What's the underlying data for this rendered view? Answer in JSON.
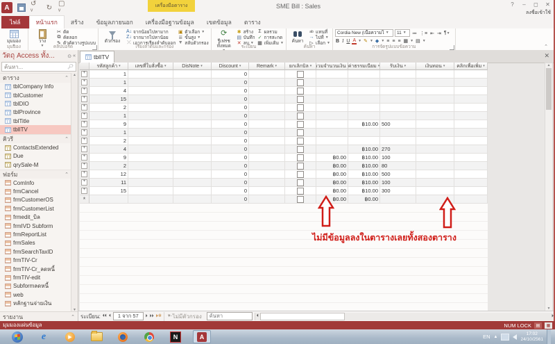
{
  "window": {
    "title": "SME Bill : Sales",
    "sign_in": "ลงชื่อเข้าใช้",
    "controls": {
      "help": "?",
      "minimize": "‒",
      "restore": "◻",
      "close": "✕"
    },
    "qat_icons": [
      "access-logo",
      "save",
      "undo",
      "redo",
      "touch-mode"
    ]
  },
  "ribbon": {
    "contextual_header": "เครื่องมือตาราง",
    "tabs": [
      {
        "label": "ไฟล์",
        "type": "file"
      },
      {
        "label": "หน้าแรก",
        "selected": true
      },
      {
        "label": "สร้าง"
      },
      {
        "label": "ข้อมูลภายนอก"
      },
      {
        "label": "เครื่องมือฐานข้อมูล"
      },
      {
        "label": "เขตข้อมูล",
        "contextual": true
      },
      {
        "label": "ตาราง",
        "contextual": true
      }
    ],
    "groups": {
      "views": {
        "label": "มุมมอง",
        "view": "มุมมอง"
      },
      "clipboard": {
        "label": "คลิปบอร์ด",
        "paste": "วาง",
        "cut": "ตัด",
        "copy": "คัดลอก",
        "format_painter": "ตัวคัดวางรูปแบบ"
      },
      "sort": {
        "label": "เรียงลำดับและกรอง",
        "filter": "ตัวกรอง",
        "asc": "จากน้อยไปหามาก",
        "desc": "จากมากไปหาน้อย",
        "remove": "เอาการเรียงลำดับออก",
        "selection": "ตัวเลือก",
        "advanced": "ขั้นสูง",
        "toggle": "สลับตัวกรอง"
      },
      "records": {
        "label": "ระเบียน",
        "refresh": "รีเฟรชทั้งหมด",
        "new": "สร้าง",
        "save": "บันทึก",
        "delete": "ลบ",
        "totals": "ผลรวม",
        "spelling": "การสะกด",
        "more": "เพิ่มเติม"
      },
      "find": {
        "label": "ค้นหา",
        "find": "ค้นหา",
        "replace": "แทนที่",
        "goto": "ไปที่",
        "select": "เลือก"
      },
      "text": {
        "label": "การจัดรูปแบบข้อความ",
        "font_name": "Cordia New (เนื้อความไ",
        "font_size": "11",
        "bold": "B",
        "italic": "I",
        "underline": "U"
      }
    }
  },
  "nav_pane": {
    "title": "วัตถุ Access ทั้ง...",
    "search_placeholder": "ค้นหา...",
    "sections": [
      {
        "label": "ตาราง",
        "type": "table",
        "items": [
          "tblCompany Info",
          "tblCustomer",
          "tblDIO",
          "tblProvince",
          "tblTitle",
          "tblITV"
        ],
        "selected": "tblITV"
      },
      {
        "label": "คิวรี",
        "type": "query",
        "items": [
          "ContactsExtended",
          "Due",
          "qrySale-M"
        ]
      },
      {
        "label": "ฟอร์ม",
        "type": "form",
        "items": [
          "ComInfo",
          "frmCancel",
          "frmCustomerOS",
          "frmCustomerList",
          "frmedit_บิล",
          "frmIVD Subform",
          "frmReportList",
          "frmSales",
          "frmSearchTaxID",
          "frmTIV-Cr",
          "frmTIV-Cr_ลดหนี้",
          "frmTIV-edit",
          "Subformลดหนี้",
          "web",
          "หลักฐานจ่ายเงิน"
        ]
      },
      {
        "label": "รายงาน",
        "type": "report",
        "items": []
      }
    ]
  },
  "datasheet": {
    "tab_title": "tblITV",
    "columns": [
      {
        "label": "รหัสลูกค้า",
        "key": "cust"
      },
      {
        "label": "เลขที่ใบสั่งซื้อ",
        "key": "po"
      },
      {
        "label": "DisNote",
        "key": "disnote"
      },
      {
        "label": "Discount",
        "key": "discount"
      },
      {
        "label": "Remark",
        "key": "remark"
      },
      {
        "label": "ยกเลิกบิล",
        "key": "cancel"
      },
      {
        "label": "รวมจำนวนเงิน",
        "key": "total"
      },
      {
        "label": "ค่าธรรมเนียม",
        "key": "fee"
      },
      {
        "label": "รับเงิน",
        "key": "received"
      },
      {
        "label": "เงินทอน",
        "key": "change"
      },
      {
        "label": "คลิกเพื่อเพิ่ม",
        "key": "clickadd"
      }
    ],
    "rows": [
      {
        "cust": "1",
        "discount": "0"
      },
      {
        "cust": "1",
        "discount": "0"
      },
      {
        "cust": "4",
        "discount": "0"
      },
      {
        "cust": "15",
        "discount": "0"
      },
      {
        "cust": "2",
        "discount": "0"
      },
      {
        "cust": "1",
        "discount": "0"
      },
      {
        "cust": "9",
        "discount": "0",
        "fee": "฿10.00",
        "received": "500"
      },
      {
        "cust": "1",
        "discount": "0"
      },
      {
        "cust": "2",
        "discount": "0"
      },
      {
        "cust": "4",
        "discount": "0",
        "fee": "฿10.00",
        "received": "270"
      },
      {
        "cust": "9",
        "discount": "0",
        "total": "฿0.00",
        "fee": "฿10.00",
        "received": "100"
      },
      {
        "cust": "2",
        "discount": "0",
        "total": "฿0.00",
        "fee": "฿10.00",
        "received": "80"
      },
      {
        "cust": "12",
        "discount": "0",
        "total": "฿0.00",
        "fee": "฿10.00",
        "received": "500"
      },
      {
        "cust": "11",
        "discount": "0",
        "total": "฿0.00",
        "fee": "฿10.00",
        "received": "100"
      },
      {
        "cust": "15",
        "discount": "0",
        "total": "฿0.00",
        "fee": "฿10.00",
        "received": "300"
      },
      {
        "new_row": true,
        "discount": "0",
        "total": "฿0.00",
        "fee": "฿0.00"
      }
    ]
  },
  "annotation": {
    "text": "ไม่มีข้อมูลลงในตารางเลยทั้งสองตาราง",
    "color": "#d01d18"
  },
  "record_nav": {
    "label": "ระเบียน:",
    "position": "1 จาก 57",
    "no_filter": "ไม่มีตัวกรอง",
    "search_placeholder": "ค้นหา"
  },
  "status_bar": {
    "view_label": "มุมมองแผ่นข้อมูล",
    "num_lock": "NUM LOCK"
  },
  "taskbar": {
    "icons": [
      "start",
      "internet-explorer",
      "media-player",
      "file-explorer",
      "firefox",
      "chrome",
      "notepad-plus",
      "access"
    ],
    "active_icon": "access",
    "language": "EN",
    "time": "17:02",
    "date": "24/10/2561"
  }
}
